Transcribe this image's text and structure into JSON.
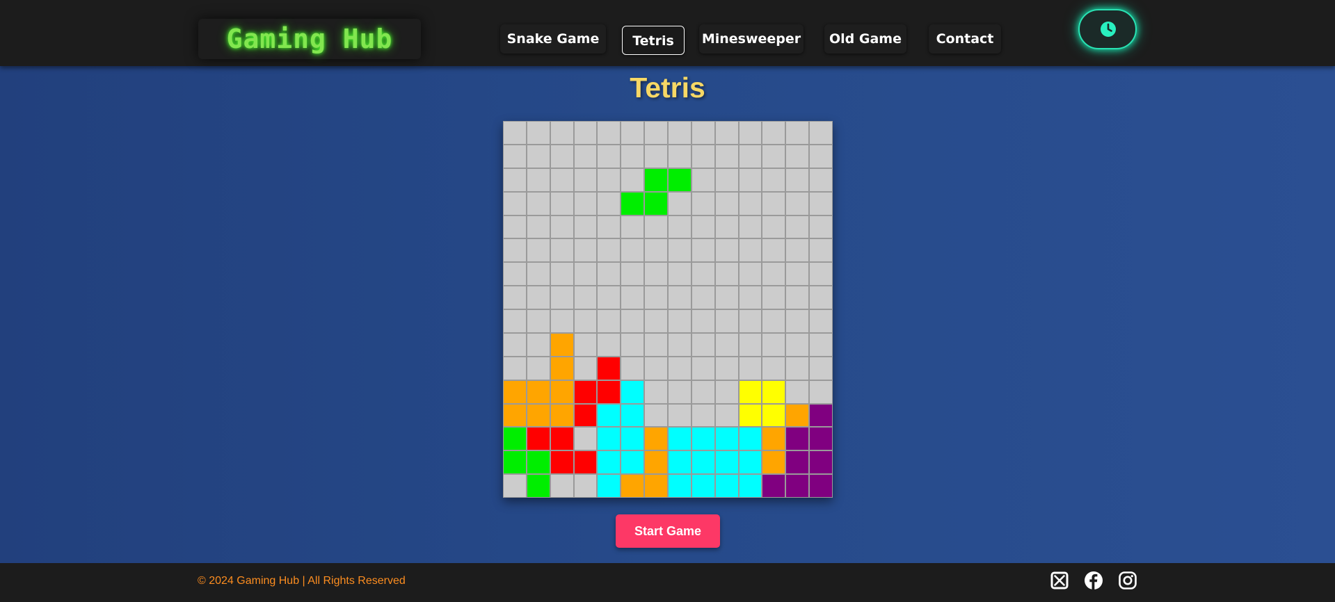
{
  "header": {
    "logo": "Gaming Hub",
    "nav": [
      {
        "label": "Snake Game",
        "active": false
      },
      {
        "label": "Tetris",
        "active": true
      },
      {
        "label": "Minesweeper",
        "active": false
      },
      {
        "label": "Old Game",
        "active": false
      },
      {
        "label": "Contact",
        "active": false
      }
    ],
    "theme_toggle_icon": "clock-icon"
  },
  "main": {
    "title": "Tetris",
    "start_button": "Start Game"
  },
  "board": {
    "columns": 14,
    "rows": 16,
    "empty_color": "#cccccc",
    "palette": {
      "G": "#00ee00",
      "O": "#ffa500",
      "R": "#ff0000",
      "C": "#00ffff",
      "Y": "#ffff00",
      "P": "#800080"
    },
    "grid": [
      "..............",
      "..............",
      "......GG......",
      ".....GG.......",
      "..............",
      "..............",
      "..............",
      "..............",
      "..............",
      "..O...........",
      "..O.R.........",
      "OOORRC....YY..",
      "OOORCC....YYOP",
      "GRR.CCOCCCCOPP",
      "GGRRCCOCCCCOPP",
      ".G..COOCCCCPPP"
    ]
  },
  "footer": {
    "copyright": "© 2024 Gaming Hub | All Rights Reserved",
    "social": [
      "x-icon",
      "facebook-icon",
      "instagram-icon"
    ]
  },
  "colors": {
    "accent_title": "#f7d865",
    "logo_green": "#82e64f",
    "start_button": "#fd3866",
    "copyright": "#fc8d20",
    "toggle_glow": "#18e5b0"
  }
}
